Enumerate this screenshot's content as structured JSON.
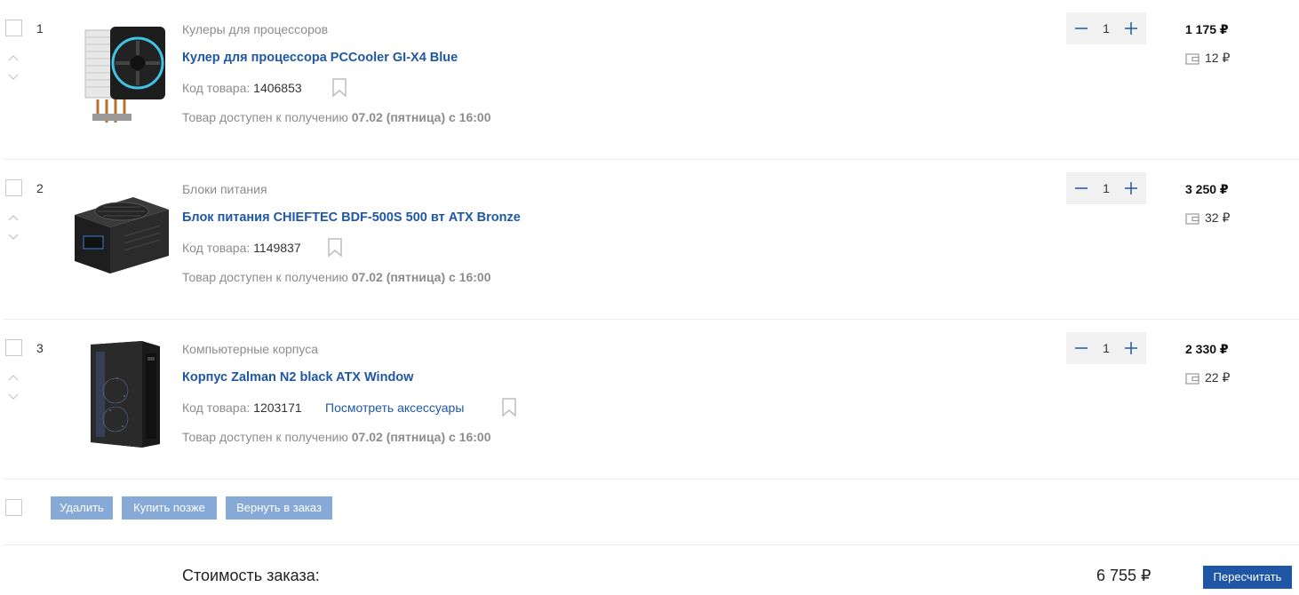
{
  "items": [
    {
      "index": "1",
      "category": "Кулеры для процессоров",
      "title": "Кулер для процессора PCCooler GI-X4 Blue",
      "code_label": "Код товара:",
      "code": "1406853",
      "accessories": "",
      "availability_prefix": "Товар доступен к получению",
      "availability_date": "07.02 (пятница) с 16:00",
      "quantity": "1",
      "price": "1 175 ₽",
      "bonus": "12 ₽",
      "image_icon": "cpu-cooler-image"
    },
    {
      "index": "2",
      "category": "Блоки питания",
      "title": "Блок питания CHIEFTEC BDF-500S 500 вт ATX Bronze",
      "code_label": "Код товара:",
      "code": "1149837",
      "accessories": "",
      "availability_prefix": "Товар доступен к получению",
      "availability_date": "07.02 (пятница) с 16:00",
      "quantity": "1",
      "price": "3 250 ₽",
      "bonus": "32 ₽",
      "image_icon": "power-supply-image"
    },
    {
      "index": "3",
      "category": "Компьютерные корпуса",
      "title": "Корпус Zalman N2 black ATX Window",
      "code_label": "Код товара:",
      "code": "1203171",
      "accessories": "Посмотреть аксессуары",
      "availability_prefix": "Товар доступен к получению",
      "availability_date": "07.02 (пятница) с 16:00",
      "quantity": "1",
      "price": "2 330 ₽",
      "bonus": "22 ₽",
      "image_icon": "pc-case-image"
    }
  ],
  "actions": {
    "delete_label": "Удалить",
    "later_label": "Купить позже",
    "return_label": "Вернуть в заказ"
  },
  "summary": {
    "total_label": "Стоимость заказа:",
    "total_value": "6 755 ₽",
    "recalc_label": "Пересчитать"
  },
  "colors": {
    "link": "#1f57a6",
    "action_button": "#86a9d8",
    "primary_button": "#1f57a6",
    "muted_text": "#8c8c8c"
  }
}
